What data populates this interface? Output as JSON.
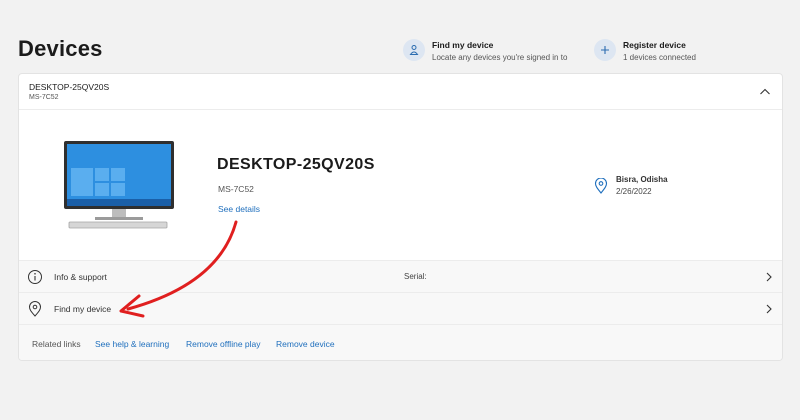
{
  "page": {
    "title": "Devices"
  },
  "header_actions": {
    "find": {
      "title": "Find my device",
      "subtitle": "Locate any devices you're signed in to",
      "icon": "person-location-icon"
    },
    "register": {
      "title": "Register device",
      "subtitle": "1 devices connected",
      "icon": "plus-icon"
    }
  },
  "device": {
    "name": "DESKTOP-25QV20S",
    "model": "MS-7C52",
    "see_details": "See details",
    "location": {
      "place": "Bisra, Odisha",
      "date": "2/26/2022"
    }
  },
  "rows": {
    "info": {
      "label": "Info & support",
      "serial_label": "Serial:"
    },
    "find": {
      "label": "Find my device"
    }
  },
  "related": {
    "label": "Related links",
    "links": [
      "See help & learning",
      "Remove offline play",
      "Remove device"
    ]
  },
  "colors": {
    "accent": "#1f6fbd",
    "annotation_arrow": "#e01f1f",
    "screen": "#2d8fe0"
  }
}
